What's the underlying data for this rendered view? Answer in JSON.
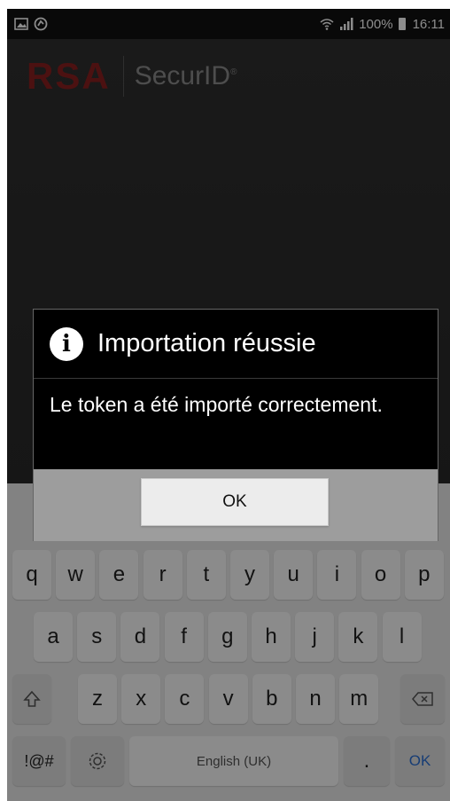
{
  "status_bar": {
    "left_icons": [
      "image-notification-icon",
      "sync-icon"
    ],
    "wifi_icon": "wifi-icon",
    "signal_icon": "signal-icon",
    "battery_text": "100%",
    "battery_icon": "battery-icon",
    "time": "16:11"
  },
  "app": {
    "logo_rsa": "RSA",
    "logo_securid": "SecurID"
  },
  "dialog": {
    "icon": "info-icon",
    "title": "Importation réussie",
    "message": "Le token a été importé correctement.",
    "ok_label": "OK"
  },
  "keyboard": {
    "row1": [
      "q",
      "w",
      "e",
      "r",
      "t",
      "y",
      "u",
      "i",
      "o",
      "p"
    ],
    "row2": [
      "a",
      "s",
      "d",
      "f",
      "g",
      "h",
      "j",
      "k",
      "l"
    ],
    "row3": [
      "z",
      "x",
      "c",
      "v",
      "b",
      "n",
      "m"
    ],
    "symbols_label": "!@#",
    "space_label": "English (UK)",
    "period_label": ".",
    "ok_label": "OK",
    "shift_icon": "shift-icon",
    "backspace_icon": "backspace-icon",
    "settings_icon": "gear-icon"
  },
  "colors": {
    "rsa_red": "#8a1f1f",
    "keyboard_ok_blue": "#2b6fd6",
    "dialog_bg": "#000000",
    "dialog_footer": "#9d9d9d"
  }
}
